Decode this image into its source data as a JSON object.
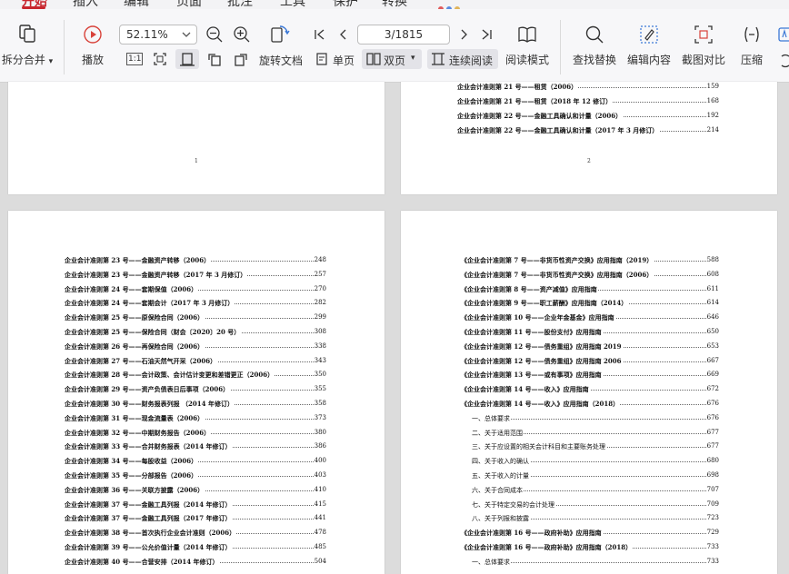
{
  "ribbon": {
    "tabs": [
      "开始",
      "插入",
      "编辑",
      "页面",
      "批注",
      "工具",
      "保护",
      "转换"
    ],
    "active_tab": "开始"
  },
  "toolbar": {
    "split_merge_label": "拆分合并",
    "play_label": "播放",
    "zoom_value": "52.11%",
    "rotate_label": "旋转文档",
    "page_indicator": "3/1815",
    "single_page_label": "单页",
    "double_page_label": "双页",
    "continuous_read_label": "连续阅读",
    "read_mode_label": "阅读模式",
    "find_replace_label": "查找替换",
    "edit_content_label": "编辑内容",
    "screenshot_compare_label": "截图对比",
    "compress_label": "压缩",
    "fit_1to1_label": "1:1"
  },
  "pages": {
    "p1_number": "1",
    "p2_number": "2",
    "p2_lines": [
      {
        "text": "企业会计准则第 21 号——租赁（2006）",
        "page": "159",
        "bold": true
      },
      {
        "text": "企业会计准则第 21 号——租赁（2018 年 12 修订）",
        "page": "168",
        "bold": true
      },
      {
        "text": "企业会计准则第 22 号——金融工具确认和计量（2006）",
        "page": "192",
        "bold": true
      },
      {
        "text": "企业会计准则第 22 号——金融工具确认和计量（2017 年 3 月修订）",
        "page": "214",
        "bold": true
      }
    ],
    "p3_lines": [
      {
        "text": "企业会计准则第 23 号——金融资产转移（2006）",
        "page": "248",
        "bold": true
      },
      {
        "text": "企业会计准则第 23 号——金融资产转移（2017 年 3 月修订）",
        "page": "257",
        "bold": true
      },
      {
        "text": "企业会计准则第 24 号——套期保值（2006）",
        "page": "270",
        "bold": true
      },
      {
        "text": "企业会计准则第 24 号——套期会计（2017 年 3 月修订）",
        "page": "282",
        "bold": true
      },
      {
        "text": "企业会计准则第 25 号——原保险合同（2006）",
        "page": "299",
        "bold": true
      },
      {
        "text": "企业会计准则第 25 号——保险合同（财会〔2020〕20 号）",
        "page": "308",
        "bold": true
      },
      {
        "text": "企业会计准则第 26 号——再保险合同（2006）",
        "page": "338",
        "bold": true
      },
      {
        "text": "企业会计准则第 27 号——石油天然气开采（2006）",
        "page": "343",
        "bold": true
      },
      {
        "text": "企业会计准则第 28 号——会计政策、会计估计变更和差错更正（2006）",
        "page": "350",
        "bold": true
      },
      {
        "text": "企业会计准则第 29 号——资产负债表日后事项（2006）",
        "page": "355",
        "bold": true
      },
      {
        "text": "企业会计准则第 30 号——财务报表列报 （2014 年修订）",
        "page": "358",
        "bold": true
      },
      {
        "text": "企业会计准则第 31 号——现金流量表（2006）",
        "page": "373",
        "bold": true
      },
      {
        "text": "企业会计准则第 32 号——中期财务报告（2006）",
        "page": "380",
        "bold": true
      },
      {
        "text": "企业会计准则第 33 号——合并财务报表（2014 年修订）",
        "page": "386",
        "bold": true
      },
      {
        "text": "企业会计准则第 34 号——每股收益（2006）",
        "page": "400",
        "bold": true
      },
      {
        "text": "企业会计准则第 35 号——分部报告（2006）",
        "page": "403",
        "bold": true
      },
      {
        "text": "企业会计准则第 36 号——关联方披露（2006）",
        "page": "410",
        "bold": true
      },
      {
        "text": "企业会计准则第 37 号——金融工具列报（2014 年修订）",
        "page": "415",
        "bold": true
      },
      {
        "text": "企业会计准则第 37 号——金融工具列报（2017 年修订）",
        "page": "441",
        "bold": true
      },
      {
        "text": "企业会计准则第 38 号——首次执行企业会计准则（2006）",
        "page": "478",
        "bold": true
      },
      {
        "text": "企业会计准则第 39 号——公允价值计量（2014 年修订）",
        "page": "485",
        "bold": true
      },
      {
        "text": "企业会计准则第 40 号——合营安排（2014 年修订）",
        "page": "504",
        "bold": true
      }
    ],
    "p4_lines": [
      {
        "text": "《企业会计准则第 7 号——非货币性资产交换》应用指南（2019）",
        "page": "588",
        "bold": true
      },
      {
        "text": "《企业会计准则第 7 号——非货币性资产交换》应用指南（2006）",
        "page": "608",
        "bold": true
      },
      {
        "text": "《企业会计准则第 8 号——资产减值》应用指南",
        "page": "611",
        "bold": true
      },
      {
        "text": "《企业会计准则第 9 号——职工薪酬》应用指南（2014）",
        "page": "614",
        "bold": true
      },
      {
        "text": "《企业会计准则第 10 号——企业年金基金》应用指南",
        "page": "646",
        "bold": true
      },
      {
        "text": "《企业会计准则第 11 号——股份支付》应用指南",
        "page": "650",
        "bold": true
      },
      {
        "text": "《企业会计准则第 12 号——债务重组》应用指南 2019",
        "page": "653",
        "bold": true
      },
      {
        "text": "《企业会计准则第 12 号——债务重组》应用指南 2006",
        "page": "667",
        "bold": true
      },
      {
        "text": "《企业会计准则第 13 号——或有事项》应用指南",
        "page": "669",
        "bold": true
      },
      {
        "text": "《企业会计准则第 14 号——收入》应用指南",
        "page": "672",
        "bold": true
      },
      {
        "text": "《企业会计准则第 14 号——收入》应用指南（2018）",
        "page": "676",
        "bold": true
      },
      {
        "text": "一、总体要求",
        "page": "676",
        "bold": false
      },
      {
        "text": "二、关于适用范围",
        "page": "677",
        "bold": false
      },
      {
        "text": "三、关于应设置的相关会计科目和主要账务处理",
        "page": "677",
        "bold": false
      },
      {
        "text": "四、关于收入的确认",
        "page": "680",
        "bold": false
      },
      {
        "text": "五、关于收入的计量",
        "page": "698",
        "bold": false
      },
      {
        "text": "六、关于合同成本",
        "page": "707",
        "bold": false
      },
      {
        "text": "七、关于特定交易的会计处理",
        "page": "709",
        "bold": false
      },
      {
        "text": "八、关于列报和披露",
        "page": "723",
        "bold": false
      },
      {
        "text": "《企业会计准则第 16 号——政府补助》应用指南",
        "page": "729",
        "bold": true
      },
      {
        "text": "《企业会计准则第 16 号——政府补助》应用指南（2018）",
        "page": "733",
        "bold": true
      },
      {
        "text": "一、总体要求",
        "page": "733",
        "bold": false
      }
    ]
  }
}
